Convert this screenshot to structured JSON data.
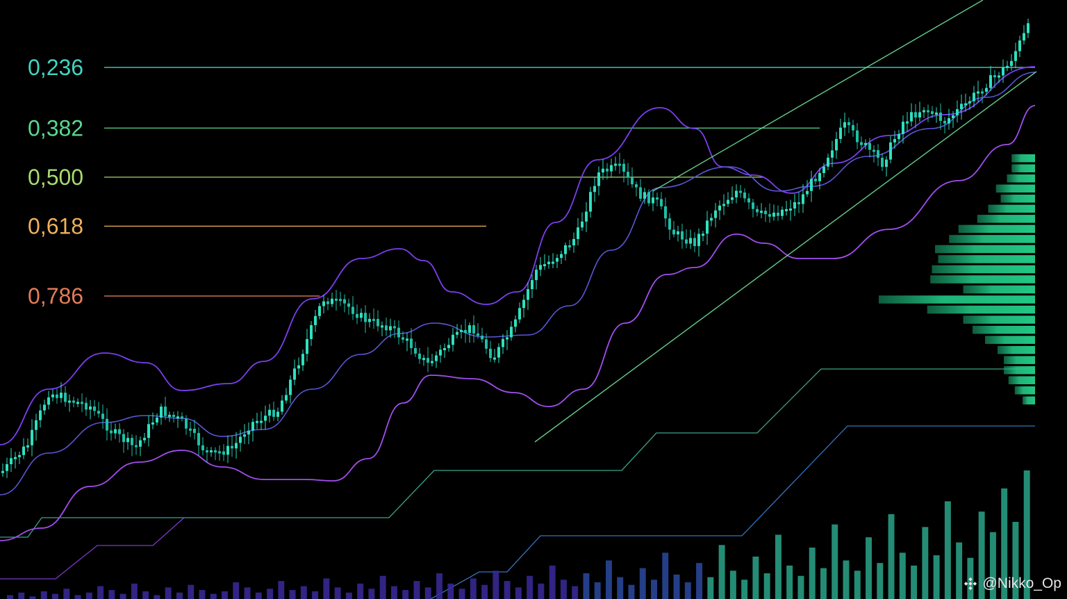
{
  "chart_data": {
    "type": "candlestick",
    "title": "",
    "xlabel": "",
    "ylabel": "",
    "grid": false,
    "fib_levels": [
      {
        "label": "0,236",
        "value": 0.236,
        "color": "#3fd6c2"
      },
      {
        "label": "0,382",
        "value": 0.382,
        "color": "#59d98f"
      },
      {
        "label": "0,500",
        "value": 0.5,
        "color": "#a8dc6e"
      },
      {
        "label": "0,618",
        "value": 0.618,
        "color": "#f0b15a"
      },
      {
        "label": "0,786",
        "value": 0.786,
        "color": "#e27d57"
      }
    ],
    "price_path": [
      [
        0,
        0.945
      ],
      [
        12,
        0.976
      ],
      [
        20,
        0.935
      ],
      [
        28,
        0.955
      ],
      [
        40,
        1.018
      ],
      [
        52,
        0.958
      ],
      [
        64,
        0.992
      ],
      [
        76,
        0.988
      ],
      [
        84,
        1.02
      ],
      [
        92,
        0.96
      ],
      [
        100,
        0.998
      ],
      [
        108,
        1.025
      ],
      [
        118,
        1.01
      ],
      [
        128,
        0.99
      ],
      [
        136,
        1.0
      ],
      [
        148,
        1.05
      ],
      [
        160,
        1.01
      ],
      [
        168,
        1.04
      ],
      [
        176,
        1.05
      ],
      [
        184,
        1.002
      ],
      [
        192,
        0.98
      ],
      [
        200,
        1.012
      ],
      [
        208,
        0.952
      ],
      [
        216,
        0.925
      ],
      [
        228,
        0.9
      ],
      [
        236,
        0.915
      ],
      [
        244,
        0.858
      ],
      [
        252,
        0.795
      ],
      [
        260,
        0.781
      ],
      [
        268,
        0.84
      ],
      [
        276,
        0.8
      ],
      [
        284,
        0.81
      ],
      [
        292,
        0.843
      ],
      [
        300,
        0.848
      ],
      [
        308,
        0.84
      ],
      [
        316,
        0.867
      ],
      [
        324,
        0.855
      ],
      [
        332,
        0.85
      ],
      [
        344,
        0.872
      ],
      [
        352,
        0.827
      ],
      [
        360,
        0.858
      ],
      [
        368,
        0.877
      ],
      [
        376,
        0.838
      ],
      [
        384,
        0.808
      ],
      [
        392,
        0.82
      ],
      [
        400,
        0.79
      ],
      [
        408,
        0.745
      ],
      [
        416,
        0.697
      ],
      [
        424,
        0.61
      ],
      [
        432,
        0.555
      ],
      [
        440,
        0.515
      ],
      [
        448,
        0.47
      ],
      [
        456,
        0.5
      ],
      [
        464,
        0.51
      ],
      [
        472,
        0.52
      ],
      [
        480,
        0.56
      ],
      [
        488,
        0.6
      ],
      [
        496,
        0.562
      ],
      [
        504,
        0.556
      ],
      [
        512,
        0.52
      ],
      [
        520,
        0.55
      ],
      [
        528,
        0.56
      ],
      [
        536,
        0.6
      ],
      [
        544,
        0.58
      ],
      [
        552,
        0.61
      ],
      [
        560,
        0.64
      ],
      [
        568,
        0.617
      ],
      [
        576,
        0.635
      ],
      [
        584,
        0.602
      ],
      [
        592,
        0.574
      ],
      [
        600,
        0.558
      ],
      [
        608,
        0.54
      ],
      [
        616,
        0.547
      ],
      [
        624,
        0.51
      ],
      [
        632,
        0.48
      ],
      [
        640,
        0.47
      ],
      [
        648,
        0.5
      ],
      [
        656,
        0.463
      ],
      [
        664,
        0.445
      ],
      [
        672,
        0.42
      ],
      [
        680,
        0.438
      ],
      [
        688,
        0.398
      ],
      [
        696,
        0.38
      ],
      [
        704,
        0.356
      ],
      [
        712,
        0.333
      ]
    ],
    "upper_band_pct": [
      [
        0,
        0.7
      ],
      [
        140,
        0.695
      ],
      [
        270,
        0.87
      ],
      [
        420,
        0.52
      ],
      [
        565,
        0.55
      ],
      [
        700,
        0.7
      ],
      [
        820,
        0.14
      ],
      [
        950,
        0.05
      ],
      [
        1060,
        0.595
      ],
      [
        1140,
        0.64
      ],
      [
        1260,
        0.56
      ],
      [
        1380,
        0.43
      ],
      [
        1490,
        0.16
      ]
    ],
    "middle_band_pct": [
      [
        0,
        0.0
      ],
      [
        150,
        0.0
      ],
      [
        262,
        0.0
      ],
      [
        430,
        0.0
      ],
      [
        590,
        0.0
      ],
      [
        720,
        0.0
      ],
      [
        830,
        0.0
      ],
      [
        950,
        0.0
      ],
      [
        1050,
        0.0
      ],
      [
        1200,
        0.0
      ],
      [
        1340,
        0.0
      ],
      [
        1490,
        0.0
      ]
    ],
    "volume_profile": [
      0.15,
      0.15,
      0.18,
      0.25,
      0.22,
      0.3,
      0.37,
      0.49,
      0.55,
      0.64,
      0.62,
      0.66,
      0.67,
      0.46,
      1.0,
      0.69,
      0.46,
      0.4,
      0.32,
      0.24,
      0.2,
      0.2,
      0.17,
      0.13,
      0.08
    ],
    "volume_bars": [
      0.03,
      0.05,
      0.02,
      0.06,
      0.04,
      0.08,
      0.03,
      0.05,
      0.1,
      0.07,
      0.04,
      0.12,
      0.06,
      0.03,
      0.09,
      0.05,
      0.11,
      0.07,
      0.04,
      0.06,
      0.13,
      0.09,
      0.05,
      0.08,
      0.14,
      0.07,
      0.1,
      0.06,
      0.16,
      0.09,
      0.05,
      0.12,
      0.08,
      0.18,
      0.1,
      0.07,
      0.14,
      0.09,
      0.2,
      0.12,
      0.08,
      0.16,
      0.11,
      0.22,
      0.14,
      0.09,
      0.18,
      0.12,
      0.26,
      0.15,
      0.1,
      0.2,
      0.13,
      0.3,
      0.17,
      0.11,
      0.24,
      0.15,
      0.36,
      0.19,
      0.13,
      0.28,
      0.17,
      0.42,
      0.22,
      0.15,
      0.33,
      0.2,
      0.5,
      0.26,
      0.18,
      0.4,
      0.24,
      0.58,
      0.3,
      0.22,
      0.48,
      0.28,
      0.66,
      0.36,
      0.26,
      0.56,
      0.34,
      0.76,
      0.44,
      0.32,
      0.68,
      0.52,
      0.86,
      0.6,
      1.0
    ]
  },
  "colors": {
    "background": "#000000",
    "candle_up": "#2fe0c0",
    "candle_down": "#1fbfa8",
    "upper_band": "#7b3ff0",
    "lower_band": "#a34ef0",
    "trend_line": "#6fe39a",
    "volume_profile": "#22c784",
    "volume_low": "#3a2a9a",
    "volume_high": "#2aa58a"
  },
  "watermark": {
    "text": "@Nikko_Op",
    "icon": "binance-logo-icon"
  }
}
